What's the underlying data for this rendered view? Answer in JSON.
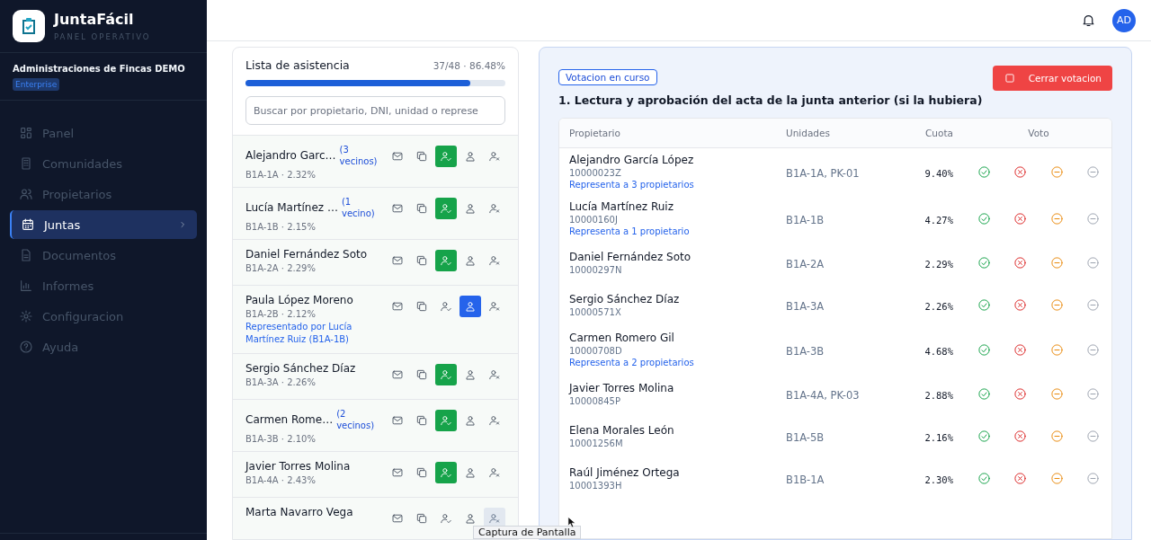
{
  "sidebar": {
    "app_name": "JuntaFácil",
    "app_subtitle": "PANEL OPERATIVO",
    "organization": "Administraciones de Fincas DEMO",
    "plan_badge": "Enterprise",
    "items": [
      {
        "label": "Panel",
        "selected": false
      },
      {
        "label": "Comunidades",
        "selected": false
      },
      {
        "label": "Propietarios",
        "selected": false
      },
      {
        "label": "Juntas",
        "selected": true
      },
      {
        "label": "Documentos",
        "selected": false
      },
      {
        "label": "Informes",
        "selected": false
      },
      {
        "label": "Configuracion",
        "selected": false
      },
      {
        "label": "Ayuda",
        "selected": false
      }
    ]
  },
  "header": {
    "avatar": "AD"
  },
  "attendance": {
    "title": "Lista de asistencia",
    "summary": "37/48 · 86.48%",
    "level": 0.865,
    "search": {
      "placeholder": "Buscar por propietario, DNI, unidad o represe"
    },
    "rows": [
      {
        "name": "Alejandro Garc…",
        "neighbors": "(3 vecinos)",
        "detail": "B1A-1A · 2.32%",
        "present": true,
        "represented": false,
        "absent": false
      },
      {
        "name": "Lucía Martínez …",
        "neighbors": "(1 vecino)",
        "detail": "B1A-1B · 2.15%",
        "present": true,
        "represented": false,
        "absent": false
      },
      {
        "name": "Daniel Fernández Soto",
        "detail": "B1A-2A · 2.29%",
        "present": true,
        "represented": false,
        "absent": false
      },
      {
        "name": "Paula López Moreno",
        "detail": "B1A-2B · 2.12%",
        "represented_by": "Representado por Lucía Martínez Ruiz (B1A-1B)",
        "present": false,
        "represented": true,
        "absent": false
      },
      {
        "name": "Sergio Sánchez Díaz",
        "detail": "B1A-3A · 2.26%",
        "present": true,
        "represented": false,
        "absent": false
      },
      {
        "name": "Carmen Rome…",
        "neighbors": "(2 vecinos)",
        "detail": "B1A-3B · 2.10%",
        "present": true,
        "represented": false,
        "absent": false
      },
      {
        "name": "Javier Torres Molina",
        "detail": "B1A-4A · 2.43%",
        "present": true,
        "represented": false,
        "absent": false
      },
      {
        "name": "Marta Navarro Vega",
        "present": false,
        "represented": false,
        "absent": true
      }
    ]
  },
  "voting": {
    "badge": "Votacion en curso",
    "close_button": "Cerrar votacion",
    "question": "1. Lectura y aprobación del acta de la junta anterior (si la hubiera)",
    "columns": [
      "Propietario",
      "Unidades",
      "Cuota",
      "Voto"
    ],
    "rows": [
      {
        "name": "Alejandro García López",
        "dni": "10000023Z",
        "represents": "Representa a 3 propietarios",
        "units": "B1A-1A, PK-01",
        "quota": "9.40%"
      },
      {
        "name": "Lucía Martínez Ruiz",
        "dni": "10000160J",
        "represents": "Representa a 1 propietario",
        "units": "B1A-1B",
        "quota": "4.27%"
      },
      {
        "name": "Daniel Fernández Soto",
        "dni": "10000297N",
        "units": "B1A-2A",
        "quota": "2.29%"
      },
      {
        "name": "Sergio Sánchez Díaz",
        "dni": "10000571X",
        "units": "B1A-3A",
        "quota": "2.26%"
      },
      {
        "name": "Carmen Romero Gil",
        "dni": "10000708D",
        "represents": "Representa a 2 propietarios",
        "units": "B1A-3B",
        "quota": "4.68%"
      },
      {
        "name": "Javier Torres Molina",
        "dni": "10000845P",
        "units": "B1A-4A, PK-03",
        "quota": "2.88%"
      },
      {
        "name": "Elena Morales León",
        "dni": "10001256M",
        "units": "B1A-5B",
        "quota": "2.16%"
      },
      {
        "name": "Raúl Jiménez Ortega",
        "dni": "10001393H",
        "units": "B1B-1A",
        "quota": "2.30%"
      }
    ]
  },
  "tooltip": "Captura de Pantalla"
}
